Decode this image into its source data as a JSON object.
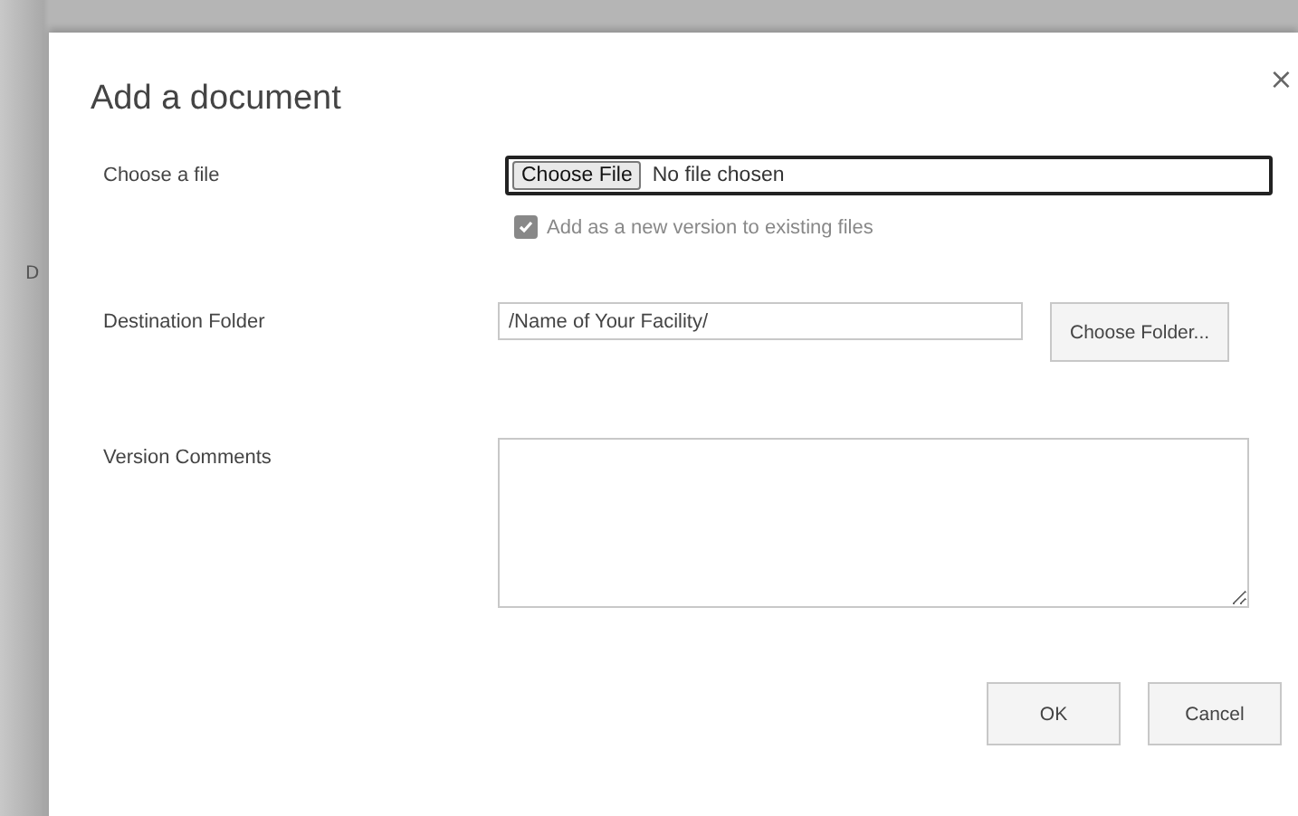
{
  "background_text": "D",
  "dialog": {
    "title": "Add a document",
    "close": "×"
  },
  "file_row": {
    "label": "Choose a file",
    "button": "Choose File",
    "status": "No file chosen",
    "focused": true
  },
  "version_option": {
    "label": "Add as a new version to existing files",
    "checked": true,
    "disabled": true
  },
  "folder_row": {
    "label": "Destination Folder",
    "value": "/Name of Your Facility/",
    "button": "Choose Folder..."
  },
  "comments_row": {
    "label": "Version Comments"
  },
  "buttons": [
    {
      "label": "OK"
    },
    {
      "label": "Cancel"
    }
  ]
}
